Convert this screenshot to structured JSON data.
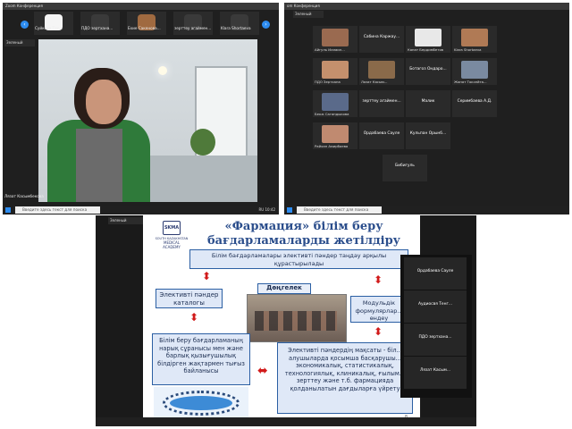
{
  "shot1": {
    "window_title": "Zoom Конференция",
    "self_tile": "Зеленый",
    "thumbnails": [
      "Суйкова Тал...",
      "ПДО зертхана...",
      "Ехие Сакенова...",
      "зерттеу агаймен...",
      "Klara Shortaeva"
    ],
    "speaker_name": "Лязат Касымбекова",
    "search_placeholder": "Введите здесь текст для поиска",
    "tray": "RU 10:42"
  },
  "shot2": {
    "window_title": "om Конференция",
    "self_tile": "Зеленый",
    "participants": [
      {
        "name": "Айгуль Исмаил...",
        "label": true
      },
      {
        "name": "Сабина Каржау...",
        "label": false
      },
      {
        "name": "Канат Бердимбетов",
        "label": true
      },
      {
        "name": "Klara Shortaeva",
        "label": true
      },
      {
        "name": "ПДО Зертхана",
        "label": true
      },
      {
        "name": "Лязат Касым...",
        "label": true
      },
      {
        "name": "Ботагоз Ондаро...",
        "label": false
      },
      {
        "name": "Жанат Токсейта...",
        "label": true
      },
      {
        "name": "Бекж Сагандыкова",
        "label": true
      },
      {
        "name": "зерттеу агаймен...",
        "label": false
      },
      {
        "name": "Малик",
        "label": false
      },
      {
        "name": "Серимбаева А.Д.",
        "label": false
      },
      {
        "name": "Райхан Амирбаева",
        "label": true
      },
      {
        "name": "Ордабаева Сауле",
        "label": false
      },
      {
        "name": "Кульпан Орынб...",
        "label": false
      },
      {
        "name": "Бибигуль",
        "label": false
      }
    ],
    "search_placeholder": "Введите здесь текст для поиска"
  },
  "shot3": {
    "self_tile": "Зеленый",
    "logo": {
      "abbr": "SKMA",
      "line1": "SOUTH KAZAKHSTAN",
      "line2": "MEDICAL",
      "line3": "ACADEMY"
    },
    "slide_title_1": "«Фармация» білім беру",
    "slide_title_2": "бағдарламаларды жетілдіру",
    "box_top": "Білім бағдарламалары элективті пәндер таңдау арқылы құрастырылады",
    "box_catalog": "Элективті пәндер каталогы",
    "round_table": "Дөңгелек үстел",
    "box_modules": "Модульдік формулярлар... өндеу",
    "box_left": "Білім беру бағдарламаның нарық сұранысы мен және барлық қызығушылық білдірген жақтармен тығыз байланысы",
    "box_right": "Элективті пәндердің мақсаты - біл... алушыларда қосымша басқарушы... экономикалық, статистикалық, технологиялық, клиникалық, ғылым... зерттеу және т.б. фармацияда қолданылатын дағдыларға үйрету",
    "page_number": "8",
    "side_participants": [
      "Ордабаева Сауле",
      "Аудиосвя Тенг...",
      "ПДО зертхана...",
      "Лязат Касым..."
    ],
    "search_placeholder": "Введите здесь текст для поиска"
  }
}
